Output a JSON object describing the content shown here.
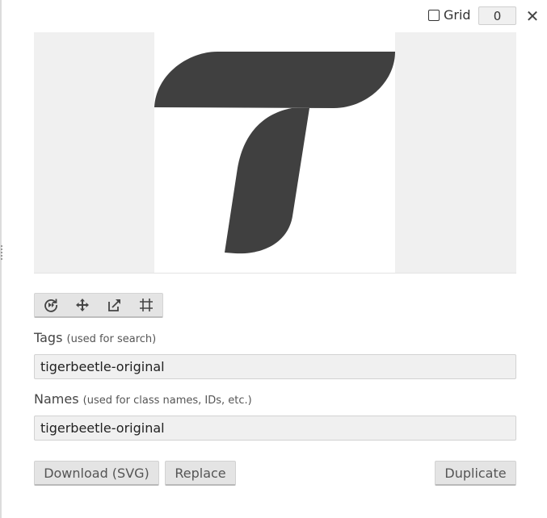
{
  "topbar": {
    "grid_label": "Grid",
    "grid_checked": false,
    "grid_value": "0",
    "close_label": "✕"
  },
  "preview": {
    "icon_name": "tigerbeetle-original",
    "icon_color": "#404040",
    "canvas_background": "#ffffff",
    "backdrop_background": "#f0f0f0"
  },
  "toolbar": {
    "tools": [
      "rotate-icon",
      "move-icon",
      "resize-icon",
      "crop-grid-icon"
    ]
  },
  "tags": {
    "label": "Tags",
    "hint": "(used for search)",
    "value": "tigerbeetle-original"
  },
  "names": {
    "label": "Names",
    "hint": "(used for class names, IDs, etc.)",
    "value": "tigerbeetle-original"
  },
  "actions": {
    "download_label": "Download (SVG)",
    "replace_label": "Replace",
    "duplicate_label": "Duplicate"
  }
}
